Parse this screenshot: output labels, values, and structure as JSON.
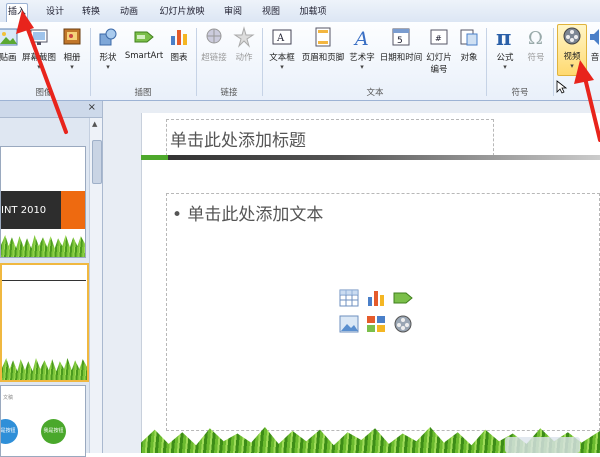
{
  "tabs": [
    {
      "label": "插入",
      "active": true
    },
    {
      "label": "设计",
      "active": false
    },
    {
      "label": "转换",
      "active": false
    },
    {
      "label": "动画",
      "active": false
    },
    {
      "label": "幻灯片放映",
      "active": false
    },
    {
      "label": "审阅",
      "active": false
    },
    {
      "label": "视图",
      "active": false
    },
    {
      "label": "加载项",
      "active": false
    }
  ],
  "ribbon": {
    "buttons": {
      "picture": "贴画",
      "screenshot": "屏幕截图",
      "album": "相册",
      "shapes": "形状",
      "smartart": "SmartArt",
      "chart": "图表",
      "hyperlink": "超链接",
      "action": "动作",
      "textbox": "文本框",
      "header_footer": "页眉和页脚",
      "wordart": "艺术字",
      "datetime": "日期和时间",
      "slide_number_1": "幻灯片",
      "slide_number_2": "编号",
      "object": "对象",
      "equation": "公式",
      "symbol": "符号",
      "video": "视频",
      "audio_partial": "音"
    },
    "groups": {
      "images": "图像",
      "illustrations": "插图",
      "links": "链接",
      "text": "文本",
      "symbols": "符号"
    }
  },
  "left_panel": {
    "close": "×",
    "thumb1_text": "INT 2010",
    "thumb3_text": "文稿",
    "thumb3_badge": "我是按钮"
  },
  "slide": {
    "title_placeholder": "单击此处添加标题",
    "content_placeholder": "• 单击此处添加文本"
  },
  "colors": {
    "accent_green": "#4da82b",
    "annotation_red": "#e8241c",
    "video_highlight": "#ffd970"
  }
}
